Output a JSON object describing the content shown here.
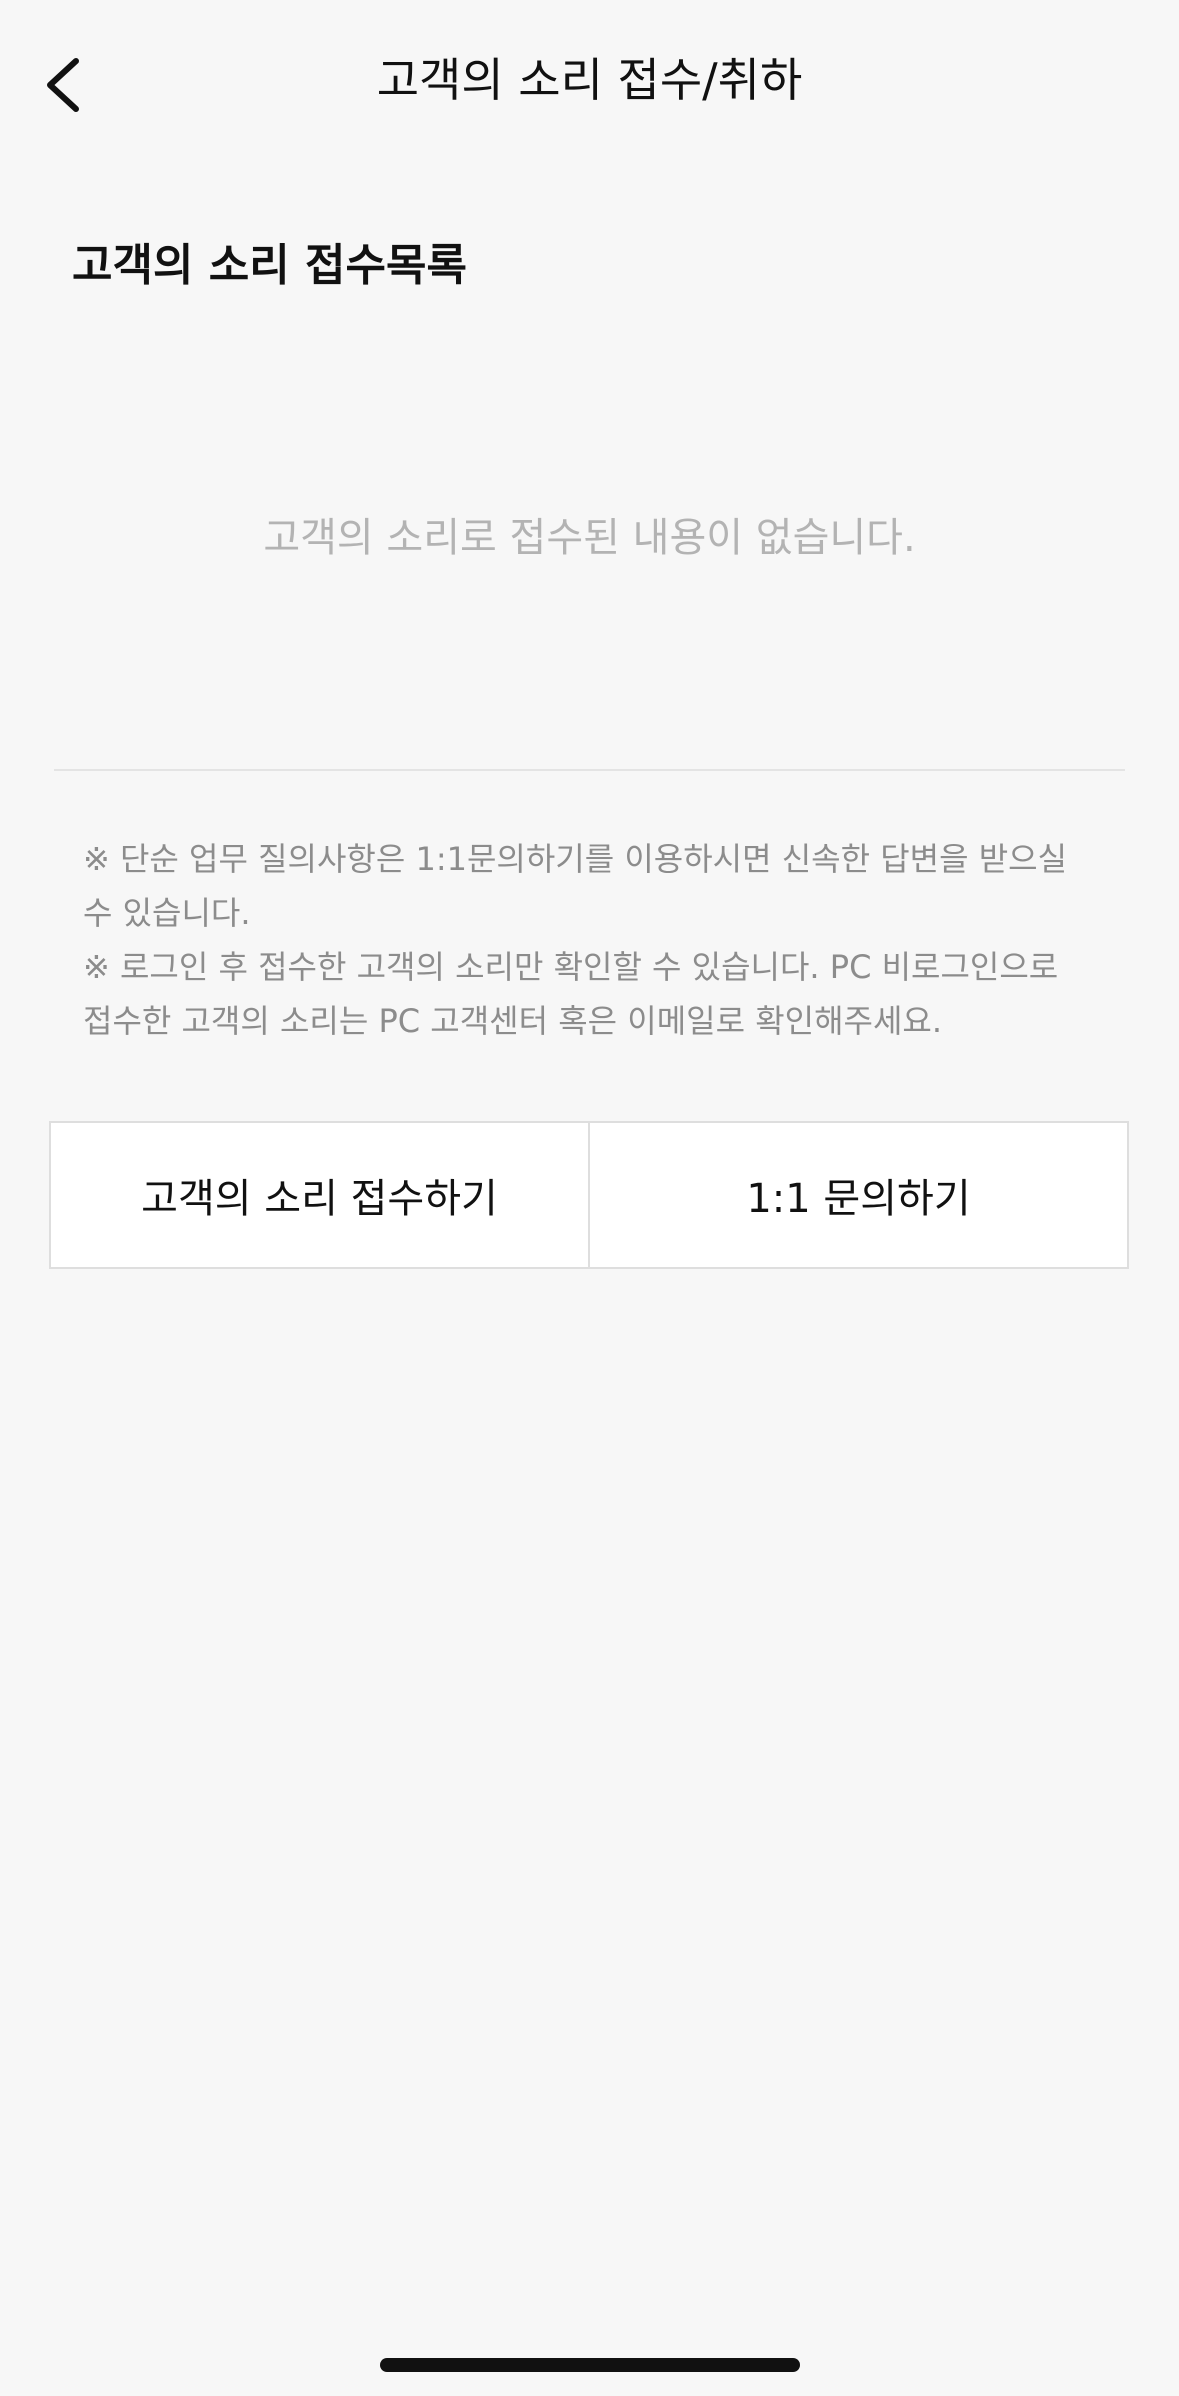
{
  "header": {
    "back_icon": "chevron-left-icon",
    "title": "고객의 소리 접수/취하"
  },
  "list": {
    "section_title": "고객의 소리 접수목록",
    "empty_message": "고객의 소리로 접수된 내용이 없습니다."
  },
  "notice": {
    "lines": [
      "※ 단순 업무 질의사항은 1:1문의하기를 이용하시면 신속한 답변을 받으실 수 있습니다.",
      "※ 로그인 후 접수한 고객의 소리만 확인할 수 있습니다. PC 비로그인으로 접수한 고객의 소리는 PC 고객센터 혹은 이메일로 확인해주세요."
    ]
  },
  "actions": {
    "submit_voc_label": "고객의 소리 접수하기",
    "inquiry_label": "1:1 문의하기"
  }
}
